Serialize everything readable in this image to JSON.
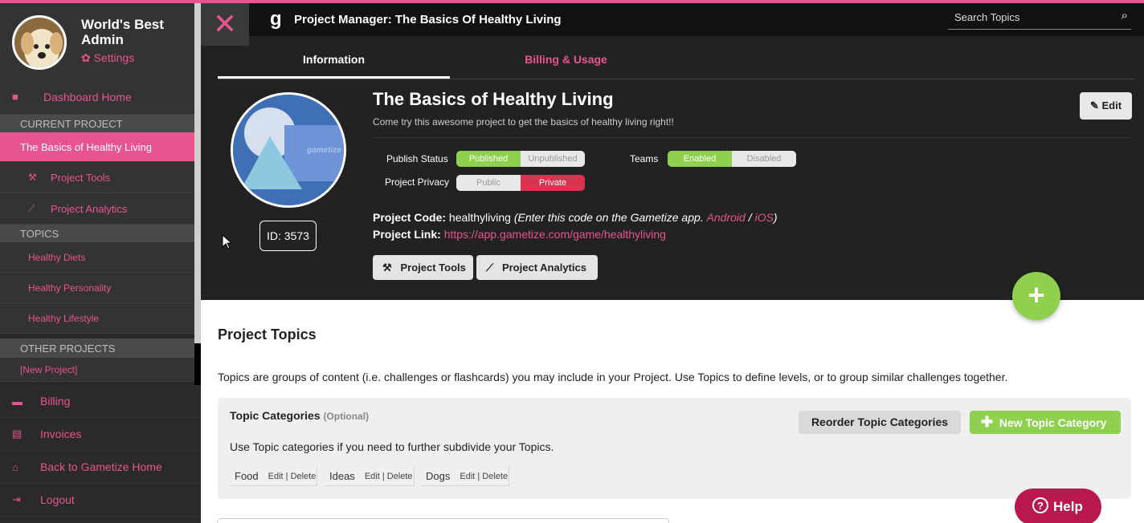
{
  "profile": {
    "name": "World's Best Admin",
    "settings_label": "Settings"
  },
  "sidebar": {
    "dashboard": "Dashboard Home",
    "current_project_header": "CURRENT PROJECT",
    "current_project": "The Basics of Healthy Living",
    "project_tools": "Project Tools",
    "project_analytics": "Project Analytics",
    "topics_header": "TOPICS",
    "topics": [
      "Healthy Diets",
      "Healthy Personality",
      "Healthy Lifestyle"
    ],
    "other_projects_header": "OTHER PROJECTS",
    "new_project": "[New Project]",
    "billing": "Billing",
    "invoices": "Invoices",
    "back_home": "Back to Gametize Home",
    "logout": "Logout"
  },
  "header": {
    "close_icon": "close-icon",
    "logo": "g",
    "title": "Project Manager: The Basics Of Healthy Living",
    "search_placeholder": "Search Topics"
  },
  "tabs": {
    "information": "Information",
    "billing_usage": "Billing & Usage"
  },
  "project": {
    "image_text": "gametize",
    "id_label": "ID: 3573",
    "title": "The Basics of Healthy Living",
    "description": "Come try this awesome project to get the basics of healthy living right!!",
    "edit_label": "Edit",
    "publish_status_label": "Publish Status",
    "publish_options": [
      "Published",
      "Unpublished"
    ],
    "publish_selected": "Published",
    "teams_label": "Teams",
    "teams_options": [
      "Enabled",
      "Disabled"
    ],
    "teams_selected": "Enabled",
    "privacy_label": "Project Privacy",
    "privacy_options": [
      "Public",
      "Private"
    ],
    "privacy_selected": "Private",
    "code_label": "Project Code:",
    "code_value": "healthyliving",
    "code_hint_pre": "(Enter this code on the Gametize app.",
    "android": "Android",
    "separator": "/",
    "ios": "iOS",
    "code_hint_post": ")",
    "link_label": "Project Link:",
    "link_url": "https://app.gametize.com/game/healthyliving",
    "tools_btn": "Project Tools",
    "analytics_btn": "Project Analytics",
    "add_label": "+"
  },
  "topics_section": {
    "title": "Project Topics",
    "description": "Topics are groups of content (i.e. challenges or flashcards) you may include in your Project. Use Topics to define levels, or to group similar challenges together.",
    "categories_title": "Topic Categories",
    "categories_optional": "(Optional)",
    "reorder_btn": "Reorder Topic Categories",
    "new_category_btn": "New Topic Category",
    "categories_help": "Use Topic categories if you need to further subdivide your Topics.",
    "categories": [
      {
        "name": "Food",
        "actions": "Edit | Delete"
      },
      {
        "name": "Ideas",
        "actions": "Edit | Delete"
      },
      {
        "name": "Dogs",
        "actions": "Edit | Delete"
      }
    ]
  },
  "help_btn": "Help",
  "colors": {
    "accent": "#e6558f",
    "green": "#8fd14f",
    "red": "#d9334f",
    "dark": "#222222"
  }
}
